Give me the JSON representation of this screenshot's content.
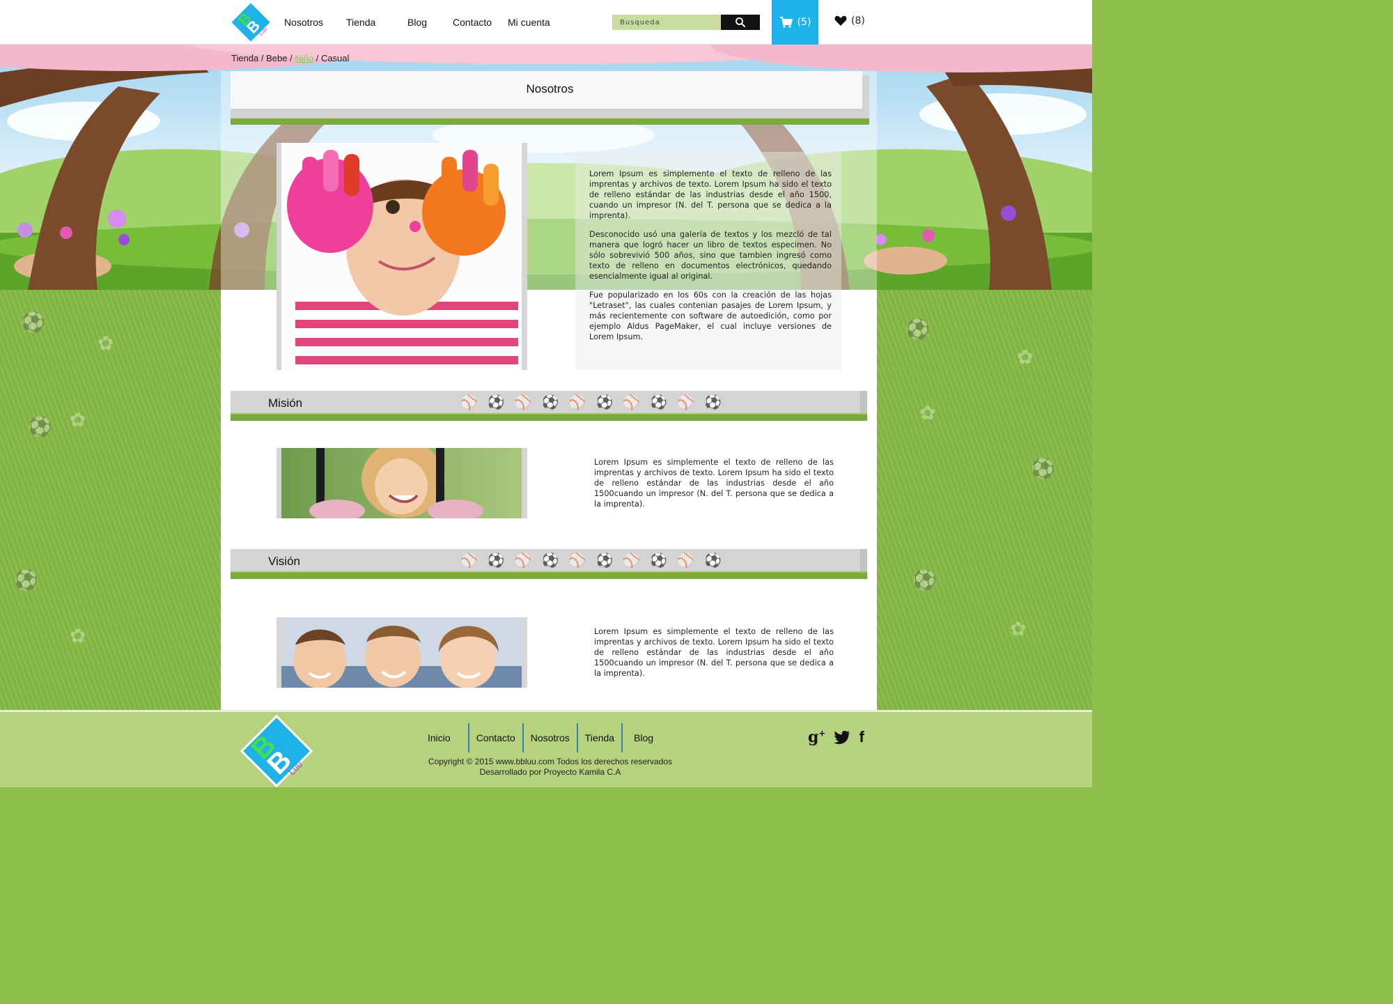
{
  "header": {
    "nav": [
      "Nosotros",
      "Tienda",
      "Blog",
      "Contacto",
      "Mi cuenta"
    ],
    "search_placeholder": "Busqueda",
    "cart_count": "(5)",
    "wishlist_count": "(8)"
  },
  "breadcrumb": {
    "items": [
      "Tienda",
      "Bebe",
      "Niño",
      "Casual"
    ],
    "separator": " / "
  },
  "about": {
    "title": "Nosotros",
    "paragraphs": [
      "Lorem Ipsum es simplemente el texto de relleno de las imprentas y archivos de texto. Lorem Ipsum ha sido el texto de relleno estándar de las industrias desde el año 1500, cuando un impresor (N. del T. persona que se dedica a la imprenta).",
      "Desconocido usó una galería de textos y los mezcló de tal manera que logró hacer un libro de textos especimen. No sólo sobrevivió 500 años, sino que tambien ingresó como texto de relleno en documentos electrónicos, quedando esencialmente igual al original.",
      "Fue popularizado en los 60s con la creación de las hojas \"Letraset\", las cuales contenian pasajes de Lorem Ipsum, y más recientemente con software de autoedición, como por ejemplo Aldus PageMaker, el cual incluye versiones de Lorem Ipsum."
    ]
  },
  "mision": {
    "title": "Misión",
    "text": "Lorem Ipsum es simplemente el texto de relleno de las imprentas y archivos de texto. Lorem Ipsum ha sido el texto de relleno estándar de las industrias desde el año 1500cuando un impresor (N. del T. persona que se dedica a la imprenta)."
  },
  "vision": {
    "title": "Visión",
    "text": "Lorem Ipsum es simplemente el texto de relleno de las imprentas y archivos de texto. Lorem Ipsum ha sido el texto de relleno estándar de las industrias desde el año 1500cuando un impresor (N. del T. persona que se dedica a la imprenta)."
  },
  "footer": {
    "nav": [
      "Inicio",
      "Contacto",
      "Nosotros",
      "Tienda",
      "Blog"
    ],
    "copyright": "Copyright © 2015 www.bbluu.com Todos los derechos reservados",
    "developer": "Desarrollado por Proyecto Kamila C.A",
    "social": [
      "google-plus-icon",
      "twitter-icon",
      "facebook-icon"
    ]
  },
  "brand": {
    "logo_text": "BB",
    "logo_sub": "Luu",
    "colors": {
      "cyan": "#1fb2e8",
      "green": "#7aaa37",
      "lime": "#3fe04a",
      "purple": "#b23fd8",
      "footer": "#b6d27e"
    }
  }
}
